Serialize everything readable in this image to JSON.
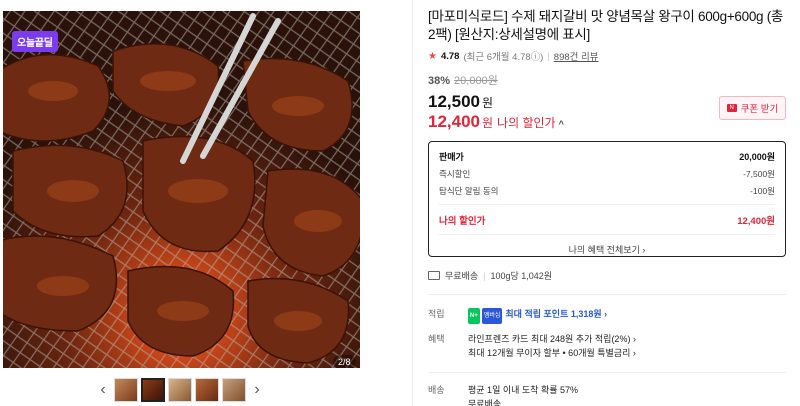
{
  "gallery": {
    "badge": "오늘끝딜",
    "counter": "2/8",
    "prev_arrow": "‹",
    "next_arrow": "›"
  },
  "product": {
    "title": "[마포미식로드] 수제 돼지갈비 맛 양념목살 왕구이 600g+600g (총 2팩) [원산지:상세설명에 표시]",
    "rating": {
      "star": "★",
      "score": "4.78",
      "recent": "(최근 6개월 4.78ⓘ)",
      "reviews": "898건 리뷰"
    },
    "discount_pct": "38%",
    "original_price": "20,000원",
    "price": "12,500",
    "price_unit": "원",
    "my_price": "12,400",
    "my_price_unit": "원",
    "my_price_label": "나의 할인가",
    "caret": "^",
    "coupon_button": "쿠폰 받기",
    "coupon_icon": "N"
  },
  "breakdown": {
    "rows": [
      {
        "label": "판매가",
        "value": "20,000원"
      },
      {
        "label": "즉시할인",
        "value": "-7,500원"
      },
      {
        "label": "탐식단 알림 동의",
        "value": "-100원"
      }
    ],
    "mine": {
      "label": "나의 할인가",
      "value": "12,400원"
    },
    "view_all": "나의 혜택 전체보기 ›"
  },
  "shipping": {
    "free": "무료배송",
    "unit_price": "100g당 1,042원"
  },
  "benefits": {
    "points_label": "적립",
    "points_badge_n": "N+",
    "points_badge_pay": "멤버십",
    "points_text": "최대 적립 포인트 1,318원 ›",
    "perks_label": "혜택",
    "perks_line1": "라인프렌즈 카드 최대 248원 추가 적립(2%) ›",
    "perks_line2": "최대 12개월 무이자 할부 • 60개월 특별금리 ›"
  },
  "delivery": {
    "label": "배송",
    "line1": "평균 1일 이내 도착 확률 57%",
    "line2": "무료배송"
  },
  "colors": {
    "accent_red": "#e0243a",
    "badge_purple": "#7b3cf0",
    "link_blue": "#2a58d8"
  }
}
